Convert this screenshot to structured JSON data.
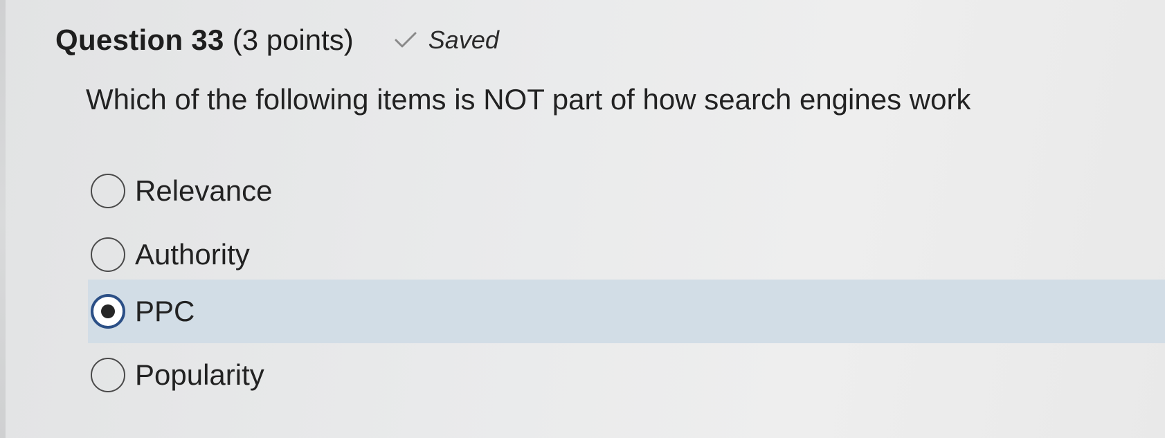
{
  "question": {
    "title": "Question 33",
    "points": "(3 points)",
    "status_icon": "check-icon",
    "status_text": "Saved",
    "prompt": "Which of the following items is NOT part of how search engines work"
  },
  "options": [
    {
      "label": "Relevance",
      "selected": false
    },
    {
      "label": "Authority",
      "selected": false
    },
    {
      "label": "PPC",
      "selected": true
    },
    {
      "label": "Popularity",
      "selected": false
    }
  ],
  "colors": {
    "selected_row": "#d2dde6",
    "radio_selected_border": "#2b4f86"
  }
}
